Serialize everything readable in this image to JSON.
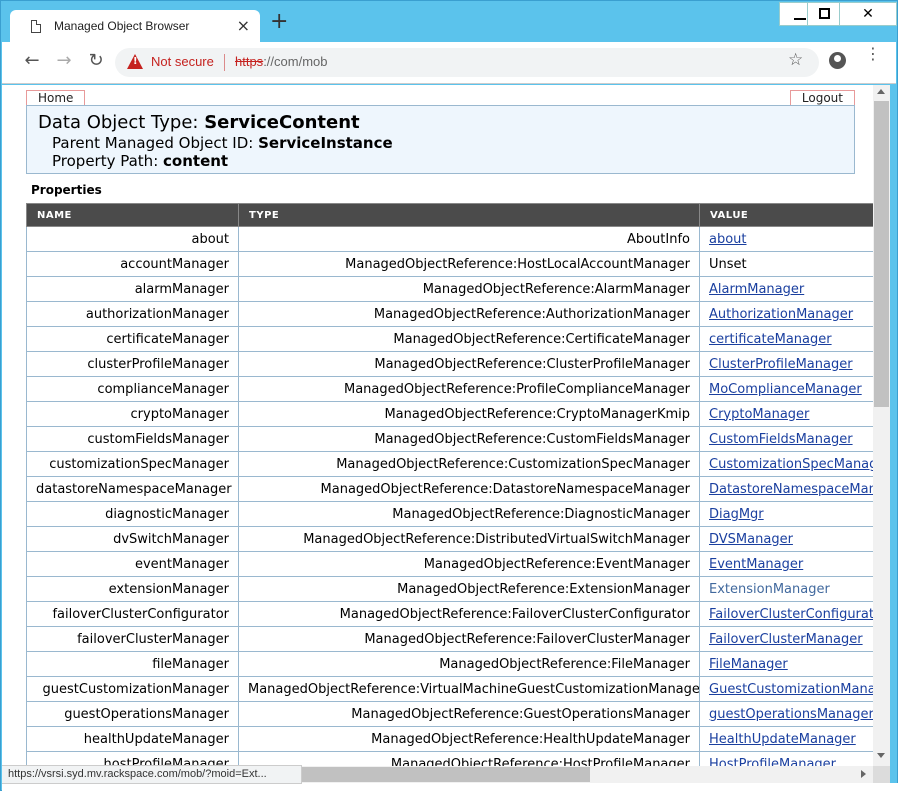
{
  "browser": {
    "tab_title": "Managed Object Browser",
    "tab_close": "×",
    "new_tab": "+",
    "not_secure": "Not secure",
    "url_scheme": "https",
    "url_rest": "://com/mob",
    "back": "←",
    "forward": "→",
    "reload": "↻",
    "star": "☆",
    "menu": "⋮",
    "window_close": "✕",
    "status_url": "https://vsrsi.syd.mv.rackspace.com/mob/?moid=Ext..."
  },
  "page": {
    "home_label": "Home",
    "logout_label": "Logout",
    "data_object_type_label": "Data Object Type:",
    "data_object_type": "ServiceContent",
    "parent_label": "Parent Managed Object ID:",
    "parent_value": "ServiceInstance",
    "property_path_label": "Property Path:",
    "property_path_value": "content",
    "properties_title": "Properties",
    "columns": [
      "NAME",
      "TYPE",
      "VALUE"
    ],
    "rows": [
      {
        "name": "about",
        "type": "AboutInfo",
        "value": "about",
        "link": true
      },
      {
        "name": "accountManager",
        "type": "ManagedObjectReference:HostLocalAccountManager",
        "value": "Unset",
        "link": false
      },
      {
        "name": "alarmManager",
        "type": "ManagedObjectReference:AlarmManager",
        "value": "AlarmManager",
        "link": true
      },
      {
        "name": "authorizationManager",
        "type": "ManagedObjectReference:AuthorizationManager",
        "value": "AuthorizationManager",
        "link": true
      },
      {
        "name": "certificateManager",
        "type": "ManagedObjectReference:CertificateManager",
        "value": "certificateManager",
        "link": true
      },
      {
        "name": "clusterProfileManager",
        "type": "ManagedObjectReference:ClusterProfileManager",
        "value": "ClusterProfileManager",
        "link": true
      },
      {
        "name": "complianceManager",
        "type": "ManagedObjectReference:ProfileComplianceManager",
        "value": "MoComplianceManager",
        "link": true
      },
      {
        "name": "cryptoManager",
        "type": "ManagedObjectReference:CryptoManagerKmip",
        "value": "CryptoManager",
        "link": true
      },
      {
        "name": "customFieldsManager",
        "type": "ManagedObjectReference:CustomFieldsManager",
        "value": "CustomFieldsManager",
        "link": true
      },
      {
        "name": "customizationSpecManager",
        "type": "ManagedObjectReference:CustomizationSpecManager",
        "value": "CustomizationSpecManag",
        "link": true
      },
      {
        "name": "datastoreNamespaceManager",
        "type": "ManagedObjectReference:DatastoreNamespaceManager",
        "value": "DatastoreNamespaceMan",
        "link": true
      },
      {
        "name": "diagnosticManager",
        "type": "ManagedObjectReference:DiagnosticManager",
        "value": "DiagMgr",
        "link": true
      },
      {
        "name": "dvSwitchManager",
        "type": "ManagedObjectReference:DistributedVirtualSwitchManager",
        "value": "DVSManager",
        "link": true
      },
      {
        "name": "eventManager",
        "type": "ManagedObjectReference:EventManager",
        "value": "EventManager",
        "link": true
      },
      {
        "name": "extensionManager",
        "type": "ManagedObjectReference:ExtensionManager",
        "value": "ExtensionManager",
        "link": "hover"
      },
      {
        "name": "failoverClusterConfigurator",
        "type": "ManagedObjectReference:FailoverClusterConfigurator",
        "value": "FailoverClusterConfigurato",
        "link": true
      },
      {
        "name": "failoverClusterManager",
        "type": "ManagedObjectReference:FailoverClusterManager",
        "value": "FailoverClusterManager",
        "link": true
      },
      {
        "name": "fileManager",
        "type": "ManagedObjectReference:FileManager",
        "value": "FileManager",
        "link": true
      },
      {
        "name": "guestCustomizationManager",
        "type": "ManagedObjectReference:VirtualMachineGuestCustomizationManager",
        "value": "GuestCustomizationManag",
        "link": true
      },
      {
        "name": "guestOperationsManager",
        "type": "ManagedObjectReference:GuestOperationsManager",
        "value": "guestOperationsManager",
        "link": true
      },
      {
        "name": "healthUpdateManager",
        "type": "ManagedObjectReference:HealthUpdateManager",
        "value": "HealthUpdateManager",
        "link": true
      },
      {
        "name": "hostProfileManager",
        "type": "ManagedObjectReference:HostProfileManager",
        "value": "HostProfileManager",
        "link": true
      }
    ]
  }
}
